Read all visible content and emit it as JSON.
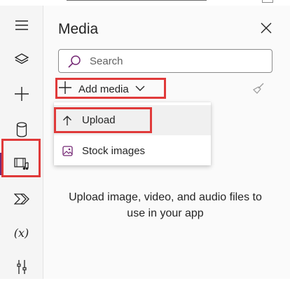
{
  "rail": {
    "items": [
      {
        "icon": "hamburger-icon"
      },
      {
        "icon": "layers-icon"
      },
      {
        "icon": "plus-icon"
      },
      {
        "icon": "database-icon"
      },
      {
        "icon": "media-icon",
        "active": true
      },
      {
        "icon": "power-automate-icon"
      },
      {
        "icon": "variables-icon",
        "label": "(x)"
      },
      {
        "icon": "tools-icon"
      }
    ]
  },
  "panel": {
    "title": "Media",
    "close_icon": "close-icon",
    "search": {
      "placeholder": "Search",
      "value": ""
    },
    "toolbar": {
      "add_media_label": "Add media",
      "clear_icon": "brush-icon"
    },
    "dropdown": {
      "items": [
        {
          "label": "Upload",
          "icon": "arrow-up-icon"
        },
        {
          "label": "Stock images",
          "icon": "image-icon"
        }
      ]
    },
    "empty_message": "Upload image, video, and audio files to use in your app"
  },
  "colors": {
    "accent": "#742774",
    "highlight": "#e03a3a",
    "rail_bg": "#f5f5f5",
    "panel_bg": "#fafafa"
  }
}
